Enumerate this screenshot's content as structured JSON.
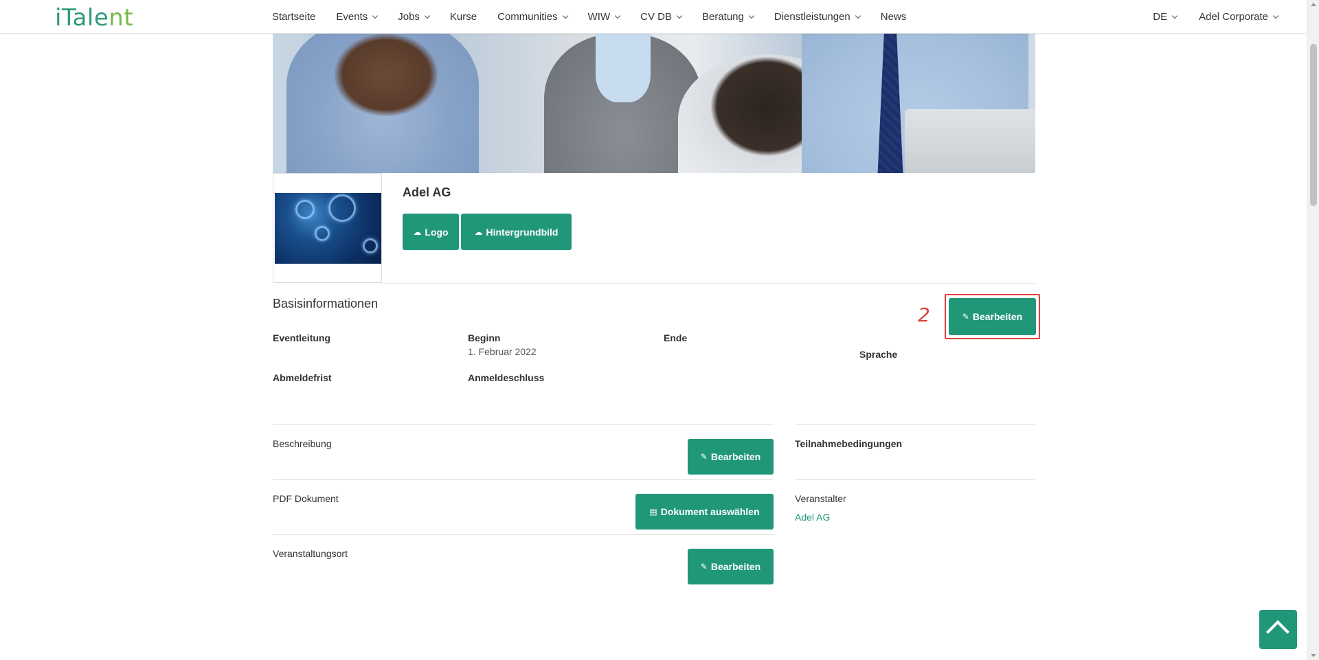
{
  "brand": {
    "logo_part1": "i",
    "logo_part2": "Tale",
    "logo_part3": "nt",
    "accent_color": "#21977a"
  },
  "nav": {
    "items": [
      {
        "label": "Startseite",
        "dropdown": false
      },
      {
        "label": "Events",
        "dropdown": true
      },
      {
        "label": "Jobs",
        "dropdown": true
      },
      {
        "label": "Kurse",
        "dropdown": false
      },
      {
        "label": "Communities",
        "dropdown": true
      },
      {
        "label": "WIW",
        "dropdown": true
      },
      {
        "label": "CV DB",
        "dropdown": true
      },
      {
        "label": "Beratung",
        "dropdown": true
      },
      {
        "label": "Dienstleistungen",
        "dropdown": true
      },
      {
        "label": "News",
        "dropdown": false
      }
    ],
    "language": "DE",
    "account": "Adel Corporate"
  },
  "profile": {
    "company_name": "Adel AG",
    "logo_button": "Logo",
    "background_button": "Hintergrundbild"
  },
  "basis": {
    "title": "Basisinformationen",
    "edit_button": "Bearbeiten",
    "annotation_number": "2",
    "fields": {
      "eventleitung": "Eventleitung",
      "beginn_label": "Beginn",
      "beginn_value": "1. Februar 2022",
      "ende": "Ende",
      "sprache": "Sprache",
      "abmeldefrist": "Abmeldefrist",
      "anmeldeschluss": "Anmeldeschluss"
    }
  },
  "sections": {
    "beschreibung_label": "Beschreibung",
    "beschreibung_button": "Bearbeiten",
    "pdf_label": "PDF Dokument",
    "pdf_button": "Dokument auswählen",
    "ort_label": "Veranstaltungsort",
    "ort_button": "Bearbeiten"
  },
  "sidebar": {
    "teilnahme_label": "Teilnahmebedingungen",
    "veranstalter_label": "Veranstalter",
    "veranstalter_value": "Adel AG"
  },
  "icons": {
    "upload": "cloud-upload-icon",
    "edit": "pencil-icon",
    "pdf": "file-pdf-icon",
    "back_to_top": "chevron-up-icon"
  }
}
